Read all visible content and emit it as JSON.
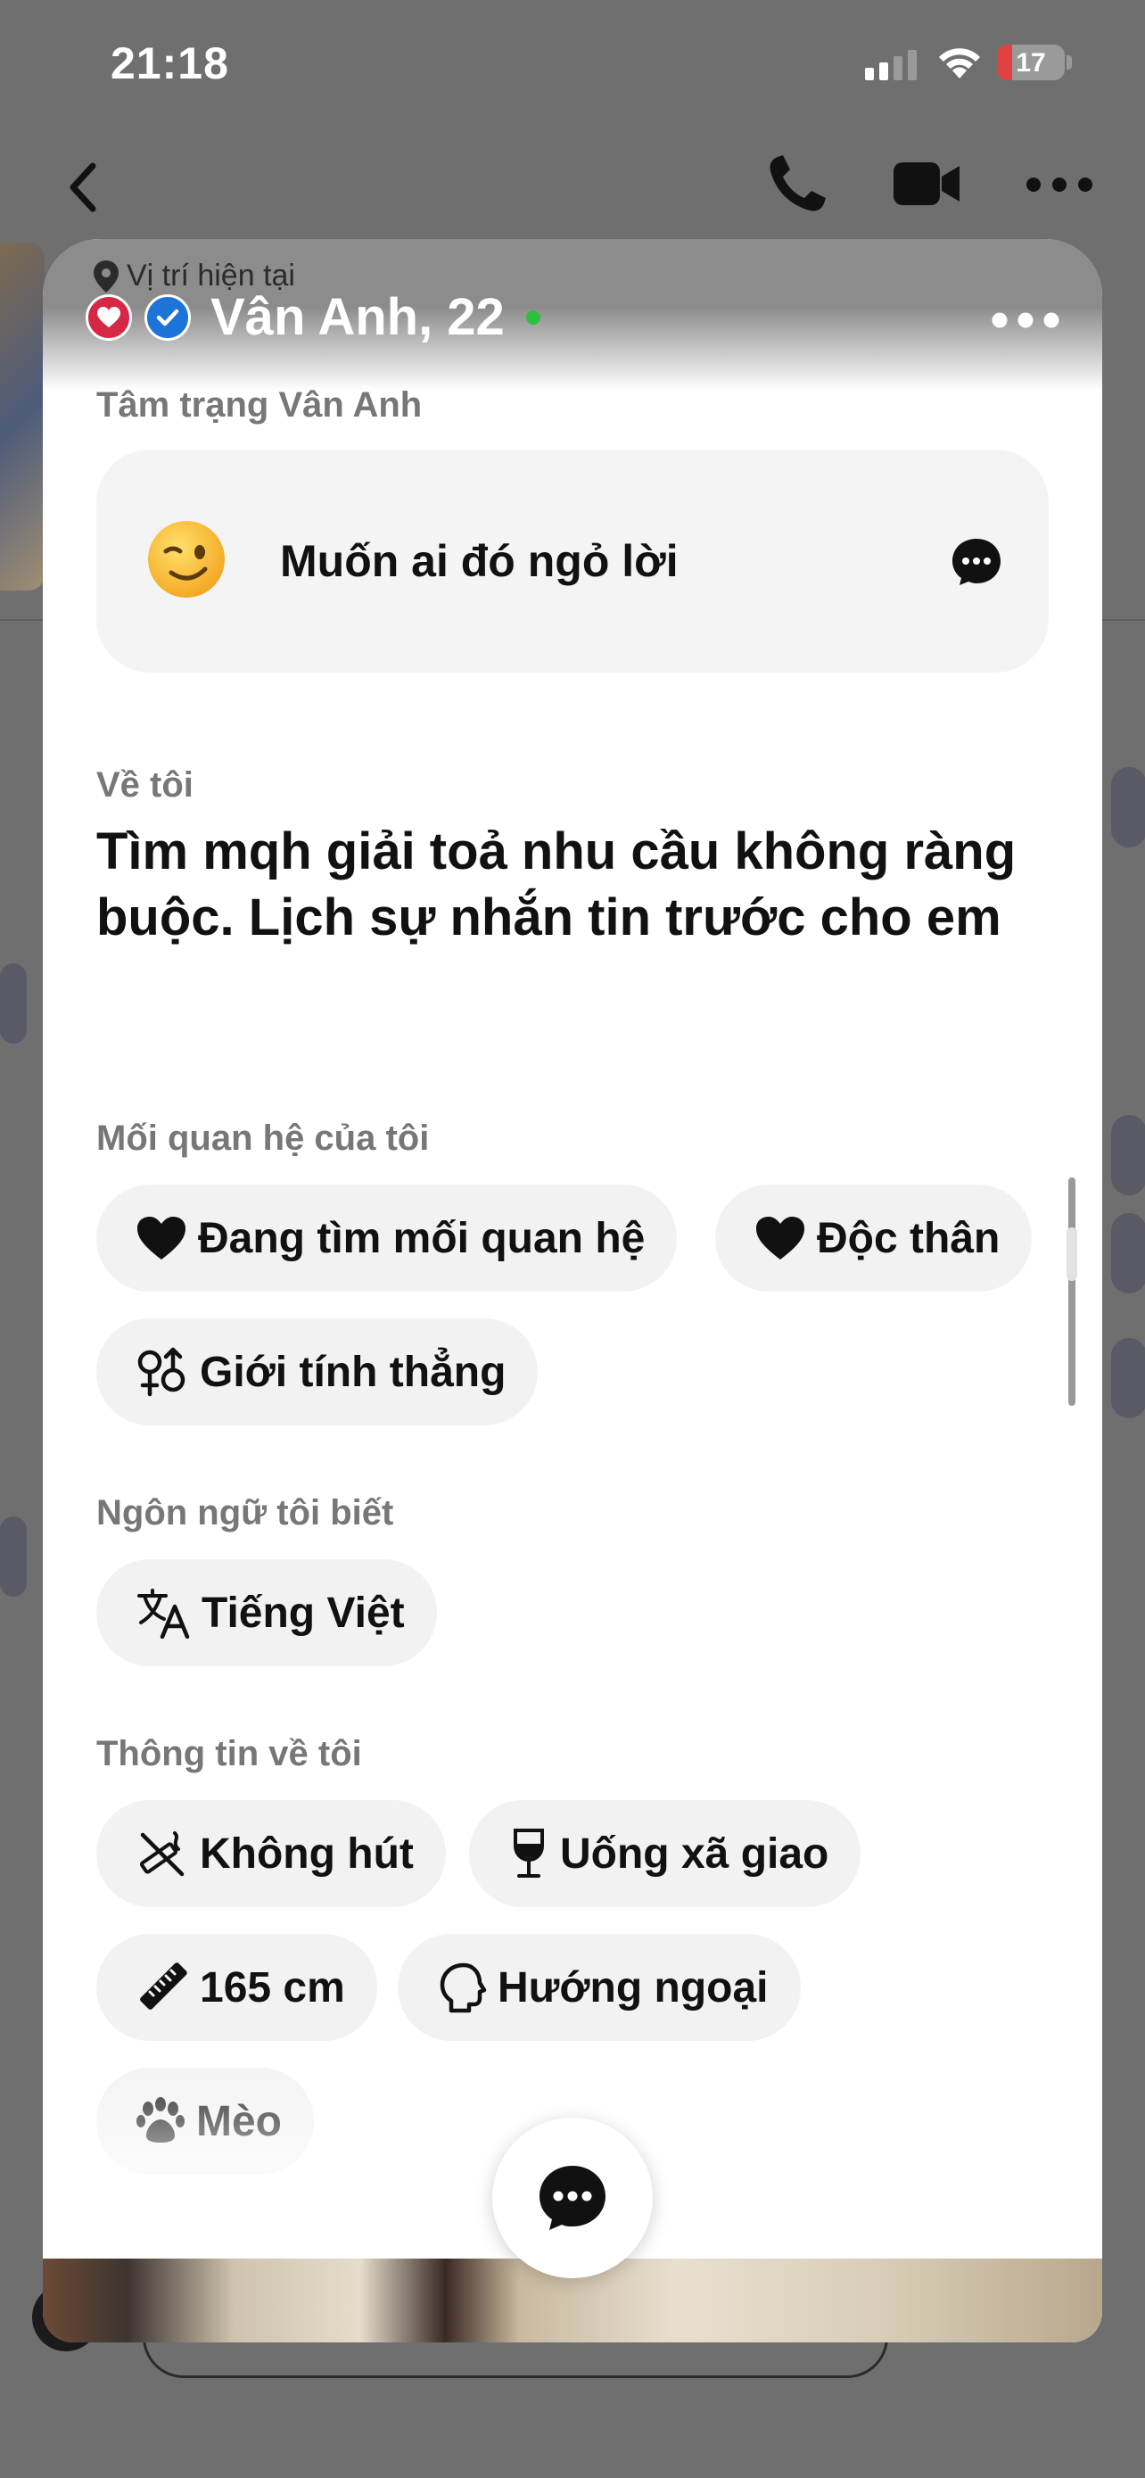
{
  "status_bar": {
    "time": "21:18",
    "battery": "17"
  },
  "profile": {
    "location_label": "Vị trí hiện tại",
    "name_age": "Vân Anh, 22",
    "mood_section_label": "Tâm trạng Vân Anh",
    "mood_text": "Muốn ai đó ngỏ lời",
    "about_label": "Về tôi",
    "about_text": "Tìm mqh giải toả nhu cầu không ràng buộc. Lịch sự nhắn tin trước cho em",
    "relationship_label": "Mối quan hệ của tôi",
    "relationship_chips": [
      "Đang tìm mối quan hệ",
      "Độc thân",
      "Giới tính thẳng"
    ],
    "language_label": "Ngôn ngữ tôi biết",
    "language_chips": [
      "Tiếng Việt"
    ],
    "info_label": "Thông tin về tôi",
    "info_chips": [
      "Không hút",
      "Uống xã giao",
      "165 cm",
      "Hướng ngoại",
      "Mèo"
    ]
  },
  "icons": {
    "mood_emoji": "winking-face-icon",
    "relationship": [
      "heart-icon",
      "heart-icon",
      "gender-icon"
    ],
    "language": [
      "translate-icon"
    ],
    "info": [
      "no-smoking-icon",
      "wine-glass-icon",
      "ruler-icon",
      "head-profile-icon",
      "paw-icon"
    ]
  },
  "colors": {
    "online": "#2fbf3f",
    "badge_red": "#d62845",
    "badge_blue": "#1d74d8"
  }
}
